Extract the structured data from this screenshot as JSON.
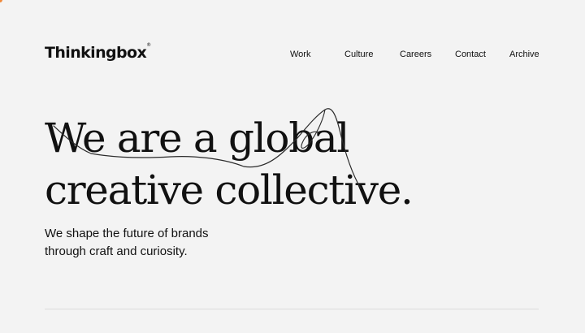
{
  "brand": {
    "name": "Thinkingbox",
    "registered_mark": "®",
    "accent_color": "#f08a3c"
  },
  "nav": {
    "items": [
      "Work",
      "Culture",
      "Careers",
      "Contact",
      "Archive"
    ]
  },
  "hero": {
    "headline_line1": "We are a global",
    "headline_line2": "creative collective.",
    "subhead_line1": "We shape the future of brands",
    "subhead_line2": "through craft and curiosity."
  },
  "colors": {
    "background": "#f3f3f3",
    "text": "#111111",
    "divider": "#dcdcdc"
  }
}
